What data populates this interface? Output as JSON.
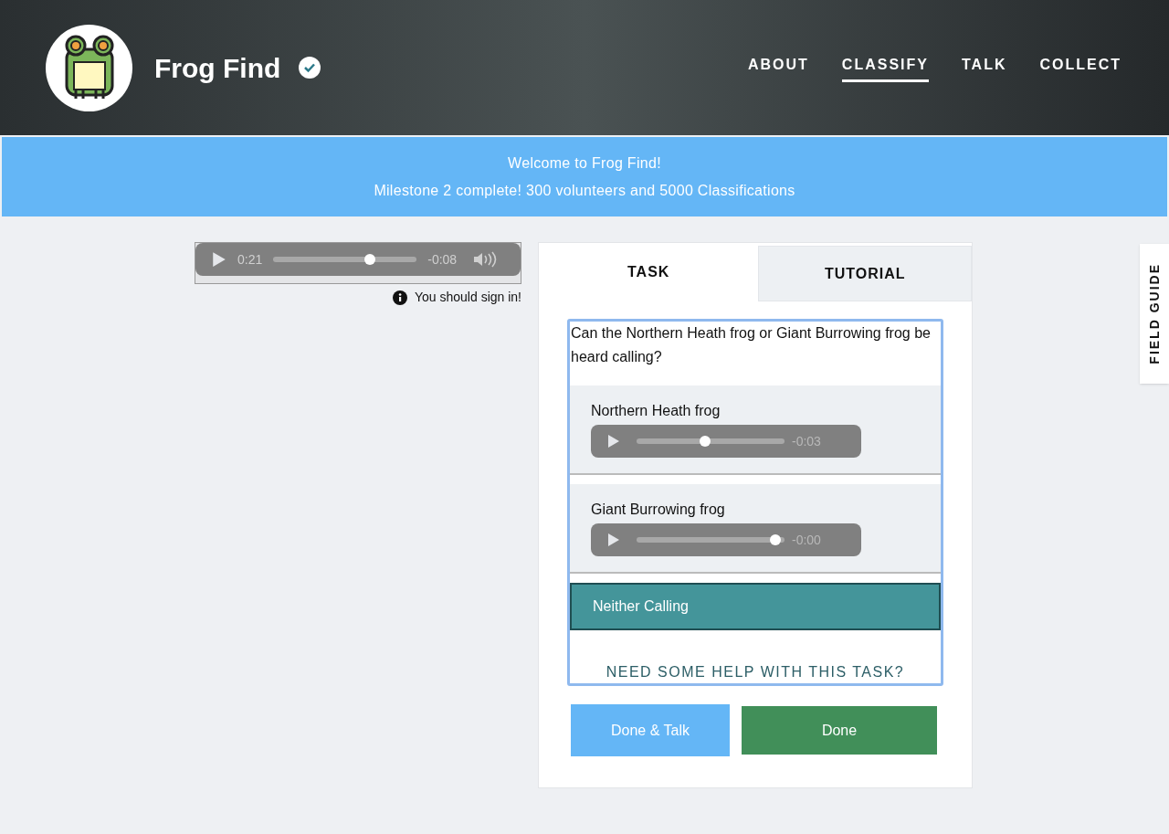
{
  "header": {
    "title": "Frog Find",
    "nav": [
      {
        "label": "ABOUT",
        "selected": false
      },
      {
        "label": "CLASSIFY",
        "selected": true
      },
      {
        "label": "TALK",
        "selected": false
      },
      {
        "label": "COLLECT",
        "selected": false
      }
    ]
  },
  "banner": {
    "lines": [
      "Welcome to Frog Find!",
      "Milestone 2 complete! 300 volunteers and 5000 Classifications"
    ]
  },
  "player": {
    "elapsed": "0:21",
    "remaining": "-0:08",
    "level": 0.69
  },
  "sign_in_notice": "You should sign in!",
  "tabs": [
    {
      "label": "TASK",
      "selected": true
    },
    {
      "label": "TUTORIAL",
      "selected": false
    }
  ],
  "question": "Can the Northern Heath frog or Giant Burrowing frog be heard calling?",
  "answers": [
    {
      "kind": "audio",
      "label": "Northern Heath frog",
      "remaining": "-0:03",
      "level": 0.46,
      "selected": false
    },
    {
      "kind": "audio",
      "label": "Giant Burrowing frog",
      "remaining": "-0:00",
      "level": 0.97,
      "selected": false
    },
    {
      "kind": "plain",
      "label": "Neither Calling",
      "selected": true
    }
  ],
  "help_link": "NEED SOME HELP WITH THIS TASK?",
  "buttons": [
    "Done & Talk",
    "Done"
  ],
  "field_guide": "FIELD GUIDE"
}
